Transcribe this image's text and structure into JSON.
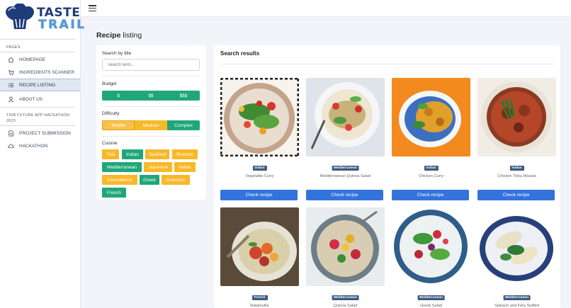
{
  "brand": {
    "line1": "TASTE",
    "line2": "TRAIL",
    "primary": "#1f3c7a",
    "secondary": "#4f9de0"
  },
  "sidebar": {
    "sections": [
      {
        "heading": "PAGES",
        "items": [
          {
            "label": "HOMEPAGE",
            "icon": "home-icon"
          },
          {
            "label": "INGREDIENTS SCANNER",
            "icon": "cart-icon"
          },
          {
            "label": "RECIPE LISTING",
            "icon": "list-icon",
            "active": true
          },
          {
            "label": "ABOUT US",
            "icon": "user-icon"
          }
        ]
      },
      {
        "heading_line1": "TIDB FUTURE APP HACKATHON",
        "heading_line2": "2023",
        "items": [
          {
            "label": "PROJECT SUBMISSION",
            "icon": "document-icon"
          },
          {
            "label": "HACKATHON",
            "icon": "cloud-icon"
          }
        ]
      }
    ]
  },
  "page": {
    "title_bold": "Recipe",
    "title_rest": " listing"
  },
  "filters": {
    "search": {
      "label": "Search by title",
      "placeholder": "Search term..."
    },
    "budget": {
      "label": "Budget",
      "options": [
        "$",
        "$$",
        "$$$"
      ]
    },
    "difficulty": {
      "label": "Difficulty",
      "options": [
        "Simple",
        "Medium",
        "Complex"
      ],
      "selected": "Simple"
    },
    "cuisine": {
      "label": "Cuisine",
      "tags": [
        "Thai",
        "Indian",
        "Seafood",
        "Russian",
        "Mediterranean",
        "Japanese",
        "Italian",
        "International",
        "Greek",
        "American",
        "French"
      ]
    },
    "colors": {
      "green": "#1fa77a",
      "orange": "#f8b828"
    }
  },
  "results": {
    "title": "Search results",
    "button_label": "Check recipe",
    "cards": [
      {
        "cuisine": "Indian",
        "name": "Vegetable Curry"
      },
      {
        "cuisine": "Mediterranean",
        "name": "Mediterranean Quinoa Salad"
      },
      {
        "cuisine": "Indian",
        "name": "Chicken Curry"
      },
      {
        "cuisine": "Indian",
        "name": "Chicken Tikka Masala"
      },
      {
        "cuisine": "French",
        "name": "Ratatouille"
      },
      {
        "cuisine": "Mediterranean",
        "name": "Quinoa Salad"
      },
      {
        "cuisine": "Mediterranean",
        "name": "Greek Salad"
      },
      {
        "cuisine": "Mediterranean",
        "name": "Spinach and Feta Stuffed"
      }
    ]
  }
}
